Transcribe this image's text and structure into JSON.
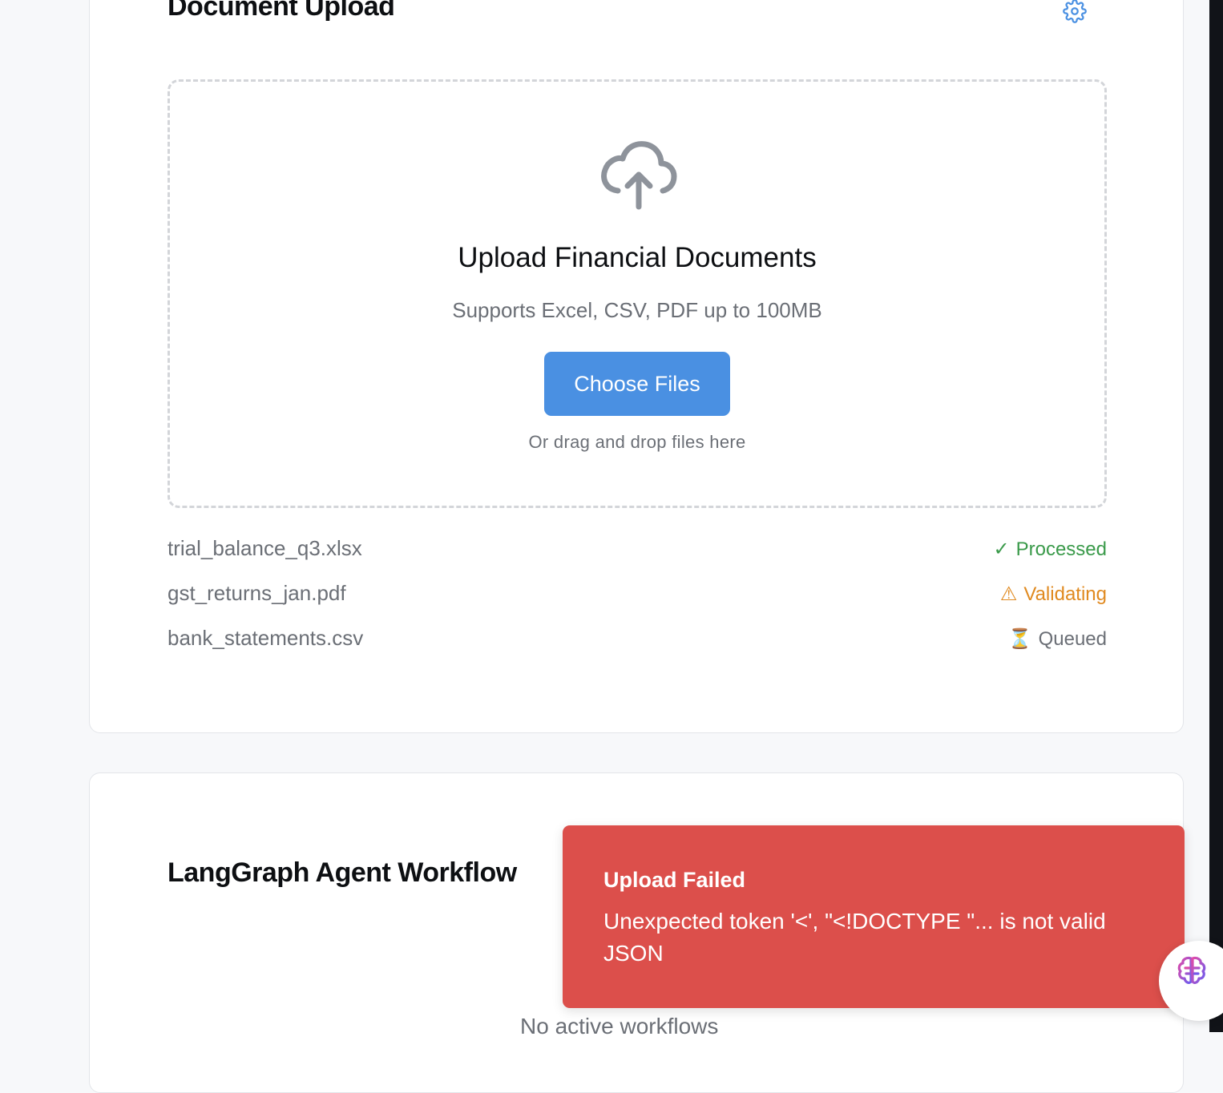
{
  "upload_card": {
    "title": "Document Upload",
    "settings_icon": "gear-icon",
    "dropzone": {
      "icon": "cloud-upload-icon",
      "title": "Upload Financial Documents",
      "subtitle": "Supports Excel, CSV, PDF up to 100MB",
      "button_label": "Choose Files",
      "hint": "Or drag and drop files here"
    },
    "files": [
      {
        "name": "trial_balance_q3.xlsx",
        "status_icon": "✓",
        "status": "Processed",
        "status_color": "#3a9a4a"
      },
      {
        "name": "gst_returns_jan.pdf",
        "status_icon": "⚠",
        "status": "Validating",
        "status_color": "#e08a20"
      },
      {
        "name": "bank_statements.csv",
        "status_icon": "⏳",
        "status": "Queued",
        "status_color": "#6b6f76"
      }
    ]
  },
  "workflow_card": {
    "title": "LangGraph Agent Workflow",
    "empty_text": "No active workflows"
  },
  "toast": {
    "title": "Upload Failed",
    "message": "Unexpected token '<', \"<!DOCTYPE \"... is not valid JSON",
    "background": "#dc4f4b"
  },
  "assistant_button": {
    "icon": "brain-icon"
  },
  "colors": {
    "accent": "#4a90e2",
    "page_background": "#f7f8fa"
  }
}
